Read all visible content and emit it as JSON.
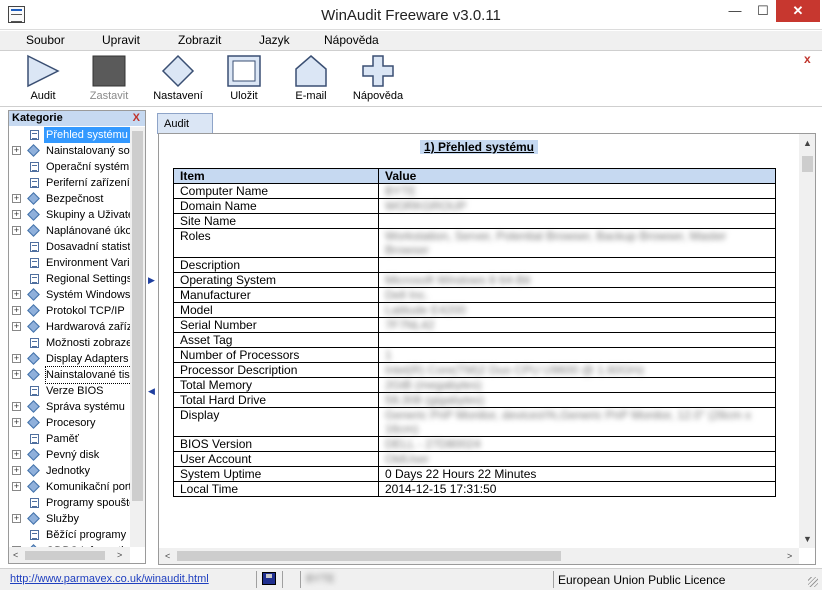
{
  "window": {
    "title": "WinAudit Freeware v3.0.11",
    "min_glyph": "—",
    "max_glyph": "☐",
    "close_glyph": "✕"
  },
  "menu": {
    "items": [
      "Soubor",
      "Upravit",
      "Zobrazit",
      "Jazyk",
      "Nápověda"
    ],
    "close_glyph": "x"
  },
  "toolbar": {
    "audit": "Audit",
    "stop": "Zastavit",
    "settings": "Nastavení",
    "save": "Uložit",
    "email": "E-mail",
    "help": "Nápověda"
  },
  "sidebar": {
    "header": "Kategorie",
    "close_glyph": "X",
    "items": [
      {
        "label": "Přehled systému",
        "expandable": false,
        "icon": "doc-icon",
        "selected": true
      },
      {
        "label": "Nainstalovaný software",
        "expandable": true,
        "icon": "diamond-icon"
      },
      {
        "label": "Operační systém",
        "expandable": false,
        "icon": "doc-icon"
      },
      {
        "label": "Periferní zařízení",
        "expandable": false,
        "icon": "doc-icon"
      },
      {
        "label": "Bezpečnost",
        "expandable": true,
        "icon": "diamond-icon"
      },
      {
        "label": "Skupiny a Uživatelé",
        "expandable": true,
        "icon": "diamond-icon"
      },
      {
        "label": "Naplánované úkoly",
        "expandable": true,
        "icon": "diamond-icon"
      },
      {
        "label": "Dosavadní statistika",
        "expandable": false,
        "icon": "doc-icon"
      },
      {
        "label": "Environment Variables",
        "expandable": false,
        "icon": "doc-icon"
      },
      {
        "label": "Regional Settings",
        "expandable": false,
        "icon": "doc-icon"
      },
      {
        "label": "Systém Windows",
        "expandable": true,
        "icon": "diamond-icon"
      },
      {
        "label": "Protokol TCP/IP",
        "expandable": true,
        "icon": "diamond-icon"
      },
      {
        "label": "Hardwarová zařízení",
        "expandable": true,
        "icon": "diamond-icon"
      },
      {
        "label": "Možnosti zobrazení",
        "expandable": false,
        "icon": "doc-icon"
      },
      {
        "label": "Display Adapters",
        "expandable": true,
        "icon": "diamond-icon"
      },
      {
        "label": "Nainstalované tiskárny",
        "expandable": true,
        "icon": "diamond-icon",
        "focused": true
      },
      {
        "label": "Verze BIOS",
        "expandable": false,
        "icon": "doc-icon"
      },
      {
        "label": "Správa systému",
        "expandable": true,
        "icon": "diamond-icon"
      },
      {
        "label": "Procesory",
        "expandable": true,
        "icon": "diamond-icon"
      },
      {
        "label": "Paměť",
        "expandable": false,
        "icon": "doc-icon"
      },
      {
        "label": "Pevný disk",
        "expandable": true,
        "icon": "diamond-icon"
      },
      {
        "label": "Jednotky",
        "expandable": true,
        "icon": "diamond-icon"
      },
      {
        "label": "Komunikační porty",
        "expandable": true,
        "icon": "diamond-icon"
      },
      {
        "label": "Programy spouštěné",
        "expandable": false,
        "icon": "doc-icon"
      },
      {
        "label": "Služby",
        "expandable": true,
        "icon": "diamond-icon"
      },
      {
        "label": "Běžící programy",
        "expandable": false,
        "icon": "doc-icon"
      },
      {
        "label": "ODBC Information",
        "expandable": true,
        "icon": "diamond-icon"
      }
    ]
  },
  "tab": {
    "label": "Audit"
  },
  "report": {
    "title": "1) Přehled systému",
    "columns": [
      "Item",
      "Value"
    ],
    "rows": [
      {
        "item": "Computer Name",
        "value": "BYTE",
        "blurred": true
      },
      {
        "item": "Domain Name",
        "value": "WORKGROUP",
        "blurred": true
      },
      {
        "item": "Site Name",
        "value": "",
        "blurred": false
      },
      {
        "item": "Roles",
        "value": "Workstation, Server, Potential Browser, Backup Browser, Master Browser",
        "blurred": true,
        "tall": true
      },
      {
        "item": "Description",
        "value": "",
        "blurred": false
      },
      {
        "item": "Operating System",
        "value": "Microsoft Windows 8 64-Bit",
        "blurred": true
      },
      {
        "item": "Manufacturer",
        "value": "Dell Inc.",
        "blurred": true
      },
      {
        "item": "Model",
        "value": "Latitude E4200",
        "blurred": true
      },
      {
        "item": "Serial Number",
        "value": "7F7NL42",
        "blurred": true
      },
      {
        "item": "Asset Tag",
        "value": "",
        "blurred": false
      },
      {
        "item": "Number of Processors",
        "value": "1",
        "blurred": true
      },
      {
        "item": "Processor Description",
        "value": "Intel(R) Core(TM)2 Duo CPU U9600 @ 1.60GHz",
        "blurred": true
      },
      {
        "item": "Total Memory",
        "value": "2GiB (megabytes)",
        "blurred": true
      },
      {
        "item": "Total Hard Drive",
        "value": "59,308 (gigabytes)",
        "blurred": true
      },
      {
        "item": "Display",
        "value": "Generic PnP Monitor, devices\\%,Generic PnP Monitor, 12.0\" (26cm x 16cm)",
        "blurred": true,
        "tall": true
      },
      {
        "item": "BIOS Version",
        "value": "DELL - 27D80024",
        "blurred": true
      },
      {
        "item": "User Account",
        "value": "OldUser",
        "blurred": true
      },
      {
        "item": "System Uptime",
        "value": "0 Days 22 Hours 22 Minutes",
        "blurred": false
      },
      {
        "item": "Local Time",
        "value": "2014-12-15 17:31:50",
        "blurred": false
      }
    ]
  },
  "status": {
    "link": "http://www.parmavex.co.uk/winaudit.html",
    "user": "BYTE",
    "licence": "European Union Public Licence"
  }
}
